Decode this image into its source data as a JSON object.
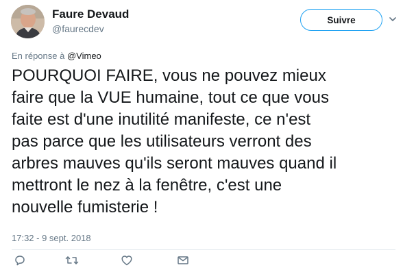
{
  "author": {
    "name": "Faure Devaud",
    "handle": "@faurecdev"
  },
  "follow_button": {
    "label": "Suivre"
  },
  "reply": {
    "prefix": "En réponse à",
    "mention": "@Vimeo"
  },
  "tweet": {
    "lines": [
      "POURQUOI FAIRE, vous ne pouvez mieux",
      "faire que la VUE humaine, tout ce que vous",
      "faite est d'une inutilité manifeste, ce n'est",
      "pas parce que les utilisateurs verront des",
      "arbres mauves qu'ils seront mauves quand il",
      "mettront le nez à la fenêtre, c'est une",
      "nouvelle fumisterie !"
    ],
    "timestamp": "17:32 - 9 sept. 2018"
  },
  "icons": {
    "menu": "chevron-down-icon",
    "reply": "reply-icon",
    "retweet": "retweet-icon",
    "like": "heart-icon",
    "message": "envelope-icon"
  },
  "colors": {
    "accent": "#1da1f2",
    "text": "#14171a",
    "secondary": "#657786"
  }
}
